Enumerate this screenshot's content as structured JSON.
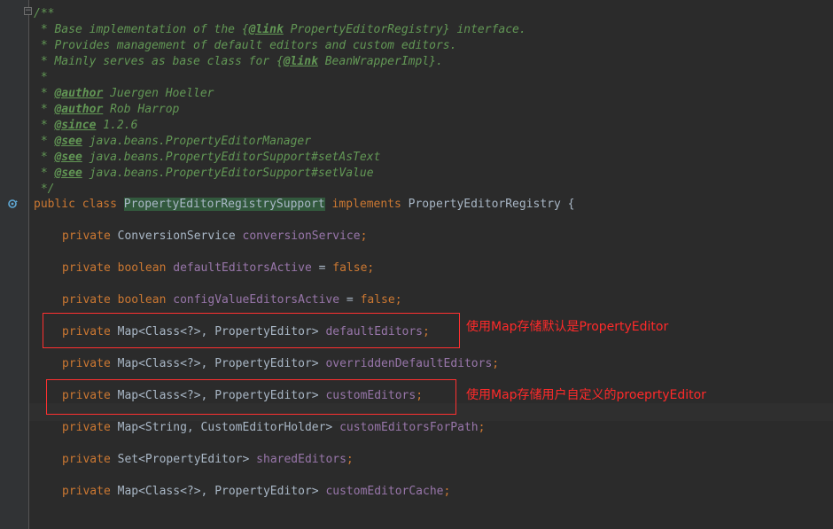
{
  "doc_comment": {
    "open": "/**",
    "line1_pre": " * Base implementation of the {",
    "line1_tag": "@link",
    "line1_post": " PropertyEditorRegistry} interface.",
    "line2": " * Provides management of default editors and custom editors.",
    "line3_pre": " * Mainly serves as base class for {",
    "line3_tag": "@link",
    "line3_post": " BeanWrapperImpl}.",
    "line4": " *",
    "author1_tag": "@author",
    "author1_value": " Juergen Hoeller",
    "author2_tag": "@author",
    "author2_value": " Rob Harrop",
    "since_tag": "@since",
    "since_value": " 1.2.6",
    "see1_tag": "@see",
    "see1_value": " java.beans.PropertyEditorManager",
    "see2_tag": "@see",
    "see2_value": " java.beans.PropertyEditorSupport#setAsText",
    "see3_tag": "@see",
    "see3_value": " java.beans.PropertyEditorSupport#setValue",
    "close": " */",
    "star_prefix": " * "
  },
  "class_decl": {
    "modifiers": "public class ",
    "class_name": "PropertyEditorRegistrySupport",
    "implements_kw": " implements ",
    "interface_name": "PropertyEditorRegistry {"
  },
  "fields": [
    {
      "modifier": "private ",
      "type": "ConversionService ",
      "name": "conversionService",
      "tail": ";"
    },
    {
      "modifier": "private ",
      "type": "boolean ",
      "name": "defaultEditorsActive",
      "tail": " = ",
      "value": "false",
      "end": ";"
    },
    {
      "modifier": "private ",
      "type": "boolean ",
      "name": "configValueEditorsActive",
      "tail": " = ",
      "value": "false",
      "end": ";"
    },
    {
      "modifier": "private ",
      "type": "Map<Class<?>, PropertyEditor> ",
      "name": "defaultEditors",
      "tail": ";"
    },
    {
      "modifier": "private ",
      "type": "Map<Class<?>, PropertyEditor> ",
      "name": "overriddenDefaultEditors",
      "tail": ";"
    },
    {
      "modifier": "private ",
      "type": "Map<Class<?>, PropertyEditor> ",
      "name": "customEditors",
      "tail": ";"
    },
    {
      "modifier": "private ",
      "type": "Map<String, CustomEditorHolder> ",
      "name": "customEditorsForPath",
      "tail": ";"
    },
    {
      "modifier": "private ",
      "type": "Set<PropertyEditor> ",
      "name": "sharedEditors",
      "tail": ";"
    },
    {
      "modifier": "private ",
      "type": "Map<Class<?>, PropertyEditor> ",
      "name": "customEditorCache",
      "tail": ";"
    }
  ],
  "annotations": [
    {
      "text": "使用Map存储默认是PropertyEditor"
    },
    {
      "text": "使用Map存储用户自定义的proeprtyEditor"
    }
  ],
  "colors": {
    "background": "#2b2b2b",
    "keyword": "#cc7832",
    "field": "#9876aa",
    "comment": "#629755",
    "annotation": "#ff2a2a"
  },
  "icons": {
    "fold": "fold-minus-icon",
    "gutter": "implements-interface-icon"
  }
}
